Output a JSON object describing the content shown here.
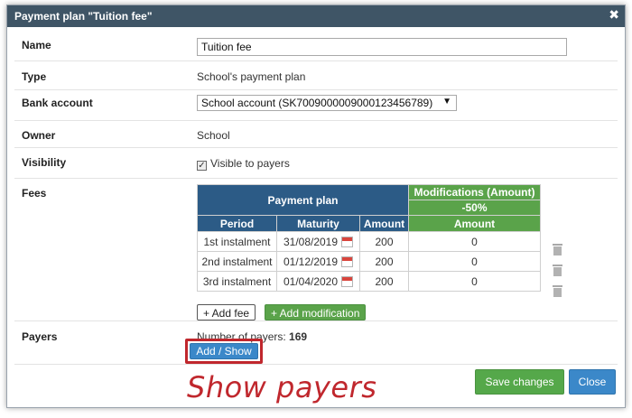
{
  "dialog": {
    "title": "Payment plan \"Tuition fee\"",
    "close_glyph": "✖"
  },
  "fields": {
    "name_label": "Name",
    "name_value": "Tuition fee",
    "type_label": "Type",
    "type_value": "School's payment plan",
    "bank_label": "Bank account",
    "bank_value": "School account (SK7009000009000123456789)",
    "bank_arrow": "▼",
    "owner_label": "Owner",
    "owner_value": "School",
    "visibility_label": "Visibility",
    "visibility_value": "Visible to payers",
    "visibility_checked": true,
    "fees_label": "Fees",
    "payers_label": "Payers",
    "payers_count_label": "Number of payers: ",
    "payers_count": "169"
  },
  "fees_table": {
    "group_plan": "Payment plan",
    "group_mod": "Modifications (Amount)",
    "mod_value": "-50%",
    "col_period": "Period",
    "col_maturity": "Maturity",
    "col_amount": "Amount",
    "col_mod_amount": "Amount",
    "rows": [
      {
        "period": "1st instalment",
        "maturity": "31/08/2019",
        "amount": "200",
        "mod": "0"
      },
      {
        "period": "2nd instalment",
        "maturity": "01/12/2019",
        "amount": "200",
        "mod": "0"
      },
      {
        "period": "3rd instalment",
        "maturity": "01/04/2020",
        "amount": "200",
        "mod": "0"
      }
    ],
    "add_fee": "+ Add fee",
    "add_modification": "+ Add modification"
  },
  "buttons": {
    "add_show": "Add / Show",
    "save": "Save changes",
    "close": "Close"
  },
  "annotation": "Show payers",
  "colors": {
    "titlebar": "#3f5566",
    "header_blue": "#2c5b86",
    "header_green": "#5aa34a",
    "primary_blue": "#3b88c9",
    "success_green": "#55a84a",
    "annotation_red": "#c0272d"
  }
}
